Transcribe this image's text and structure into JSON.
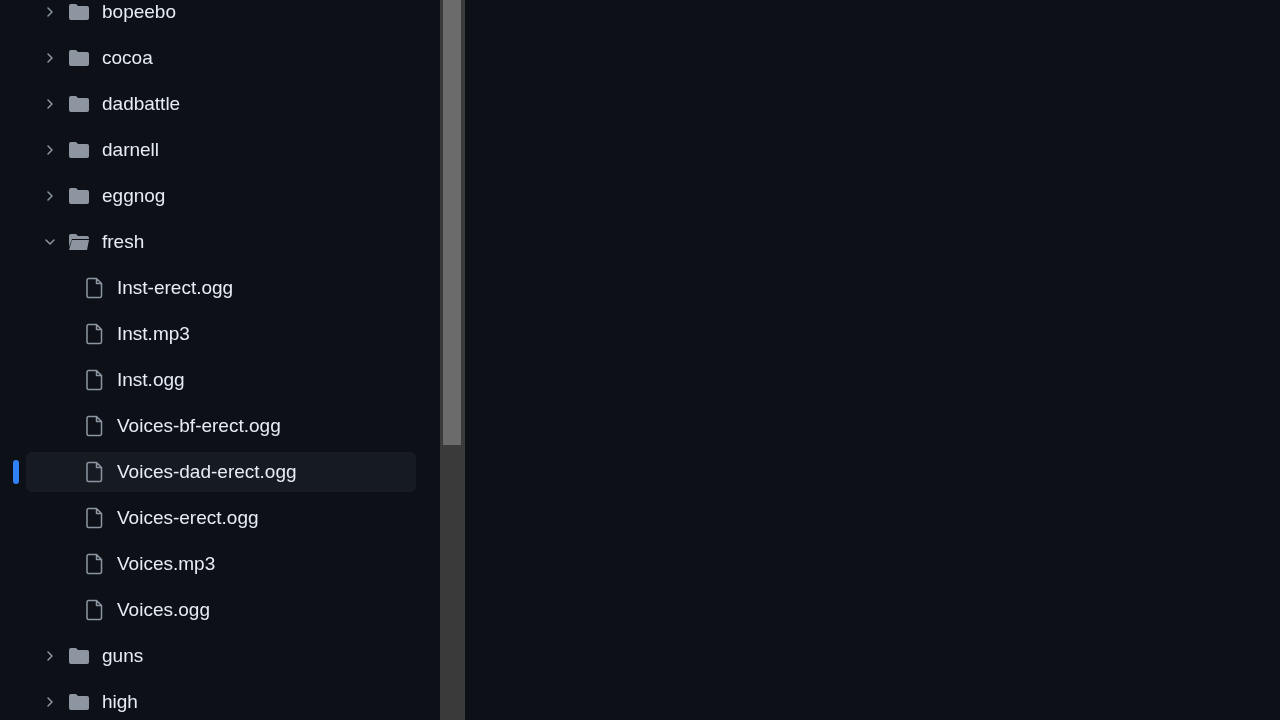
{
  "file_tree": [
    {
      "kind": "folder",
      "name": "bopeebo",
      "expanded": false,
      "selected": false
    },
    {
      "kind": "folder",
      "name": "cocoa",
      "expanded": false,
      "selected": false
    },
    {
      "kind": "folder",
      "name": "dadbattle",
      "expanded": false,
      "selected": false
    },
    {
      "kind": "folder",
      "name": "darnell",
      "expanded": false,
      "selected": false
    },
    {
      "kind": "folder",
      "name": "eggnog",
      "expanded": false,
      "selected": false
    },
    {
      "kind": "folder",
      "name": "fresh",
      "expanded": true,
      "selected": false,
      "children": [
        {
          "kind": "file",
          "name": "Inst-erect.ogg",
          "selected": false
        },
        {
          "kind": "file",
          "name": "Inst.mp3",
          "selected": false
        },
        {
          "kind": "file",
          "name": "Inst.ogg",
          "selected": false
        },
        {
          "kind": "file",
          "name": "Voices-bf-erect.ogg",
          "selected": false
        },
        {
          "kind": "file",
          "name": "Voices-dad-erect.ogg",
          "selected": true
        },
        {
          "kind": "file",
          "name": "Voices-erect.ogg",
          "selected": false
        },
        {
          "kind": "file",
          "name": "Voices.mp3",
          "selected": false
        },
        {
          "kind": "file",
          "name": "Voices.ogg",
          "selected": false
        }
      ]
    },
    {
      "kind": "folder",
      "name": "guns",
      "expanded": false,
      "selected": false
    },
    {
      "kind": "folder",
      "name": "high",
      "expanded": false,
      "selected": false
    }
  ]
}
